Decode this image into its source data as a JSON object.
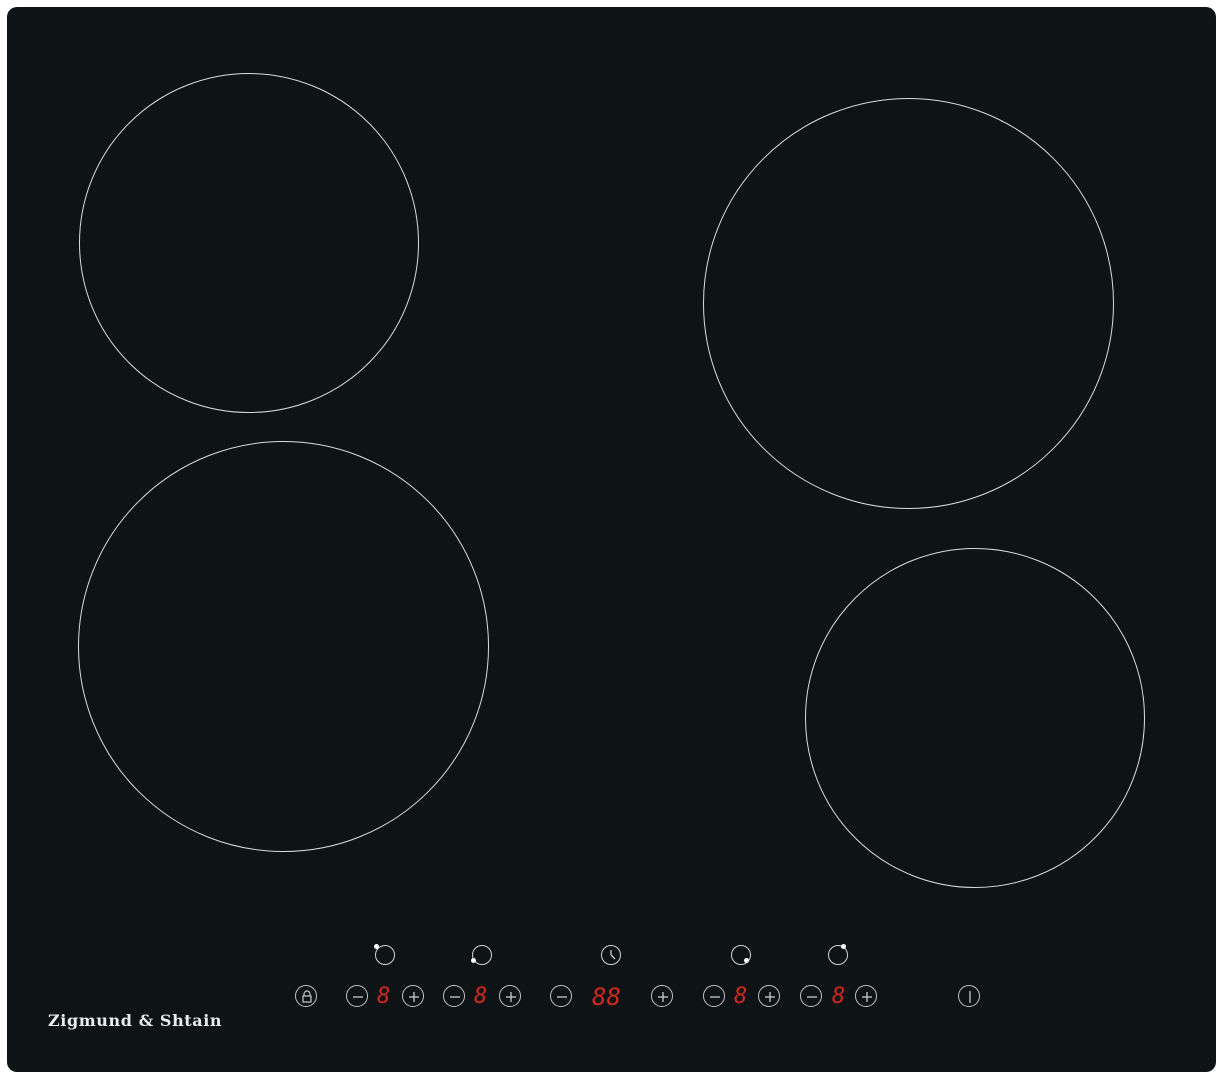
{
  "brand": {
    "name": "Zigmund & Shtain"
  },
  "colors": {
    "glass": "#0e1416",
    "ring": "#d9dcdd",
    "display": "#d2271f"
  },
  "zones": [
    {
      "name": "front-left-small"
    },
    {
      "name": "rear-left-large"
    },
    {
      "name": "rear-right-large"
    },
    {
      "name": "front-right-small"
    }
  ],
  "controls": {
    "lock_icon": "lock-icon",
    "power_icon": "power-icon",
    "timer_icon": "clock-icon",
    "zone1": {
      "display": "8"
    },
    "zone2": {
      "display": "8"
    },
    "timer": {
      "display": "88"
    },
    "zone3": {
      "display": "8"
    },
    "zone4": {
      "display": "8"
    }
  }
}
